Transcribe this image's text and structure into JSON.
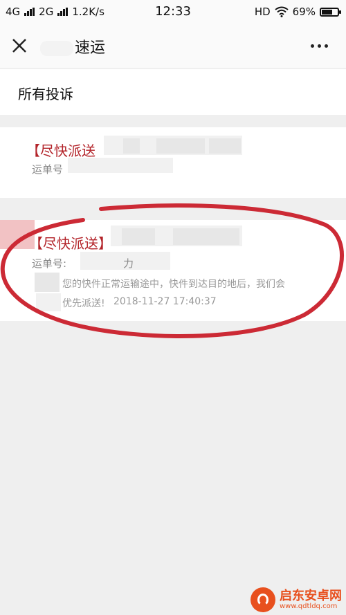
{
  "status_bar": {
    "net1": "4G",
    "net2": "2G",
    "speed": "1.2K/s",
    "time": "12:33",
    "hd": "HD",
    "battery_text": "69%",
    "battery_level": 0.69
  },
  "app_bar": {
    "title": "速运",
    "close_icon": "close-icon",
    "more_icon": "more-icon"
  },
  "section": {
    "title": "所有投诉"
  },
  "complaints": [
    {
      "title": "【尽快派送",
      "tracking_label": "运单号"
    },
    {
      "title": "【尽快派送】",
      "tracking_label": "运单号:",
      "tracking_tail": "力",
      "message_line1": "您的快件正常运输途中，快件到达目的地后，我们会",
      "message_line2": "优先派送!",
      "time": "2018-11-27 17:40:37"
    }
  ],
  "colors": {
    "accent_red": "#b3242a",
    "annotation_red": "#cc2a35",
    "watermark_orange": "#e8501e"
  },
  "watermark": {
    "name": "启东安卓网",
    "url": "www.qdtldq.com"
  }
}
